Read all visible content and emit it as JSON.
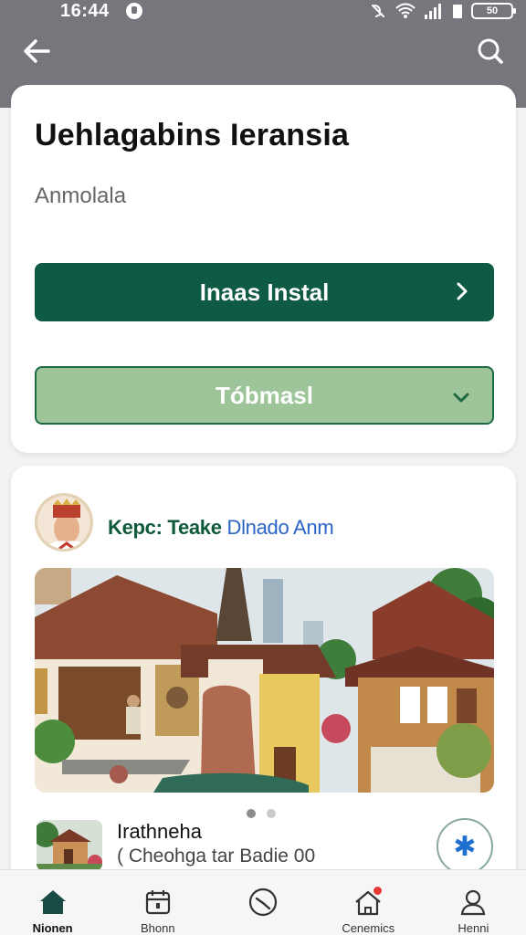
{
  "status_bar": {
    "time": "16:44",
    "battery": "50"
  },
  "header": {
    "back_icon": "arrow-left-icon",
    "search_icon": "search-icon"
  },
  "main_card": {
    "title": "Uehlagabins Ieransia",
    "subtitle": "Anmolala",
    "primary_button": "Inaas Instal",
    "secondary_button": "Tóbmasl"
  },
  "post": {
    "author_part1": "Kepc: Teake",
    "author_part2": "Dlnado Anm",
    "carousel_page": 1,
    "carousel_pages": 2,
    "item_title": "Irathneha",
    "item_subtitle": "( Cheohga tar Badie 00",
    "fav_icon": "star-icon"
  },
  "bottom_nav": [
    {
      "label": "Nionen",
      "icon": "home-icon",
      "active": true
    },
    {
      "label": "Bhonn",
      "icon": "calendar-icon",
      "active": false
    },
    {
      "label": "",
      "icon": "clock-icon",
      "active": false
    },
    {
      "label": "Cenemics",
      "icon": "house-notification-icon",
      "active": false
    },
    {
      "label": "Henni",
      "icon": "profile-icon",
      "active": false
    }
  ],
  "colors": {
    "header_bg": "#75777d",
    "primary": "#0f5a44",
    "secondary": "#9ec59a",
    "author_green": "#0e5a3a",
    "author_blue": "#2a64c7"
  }
}
